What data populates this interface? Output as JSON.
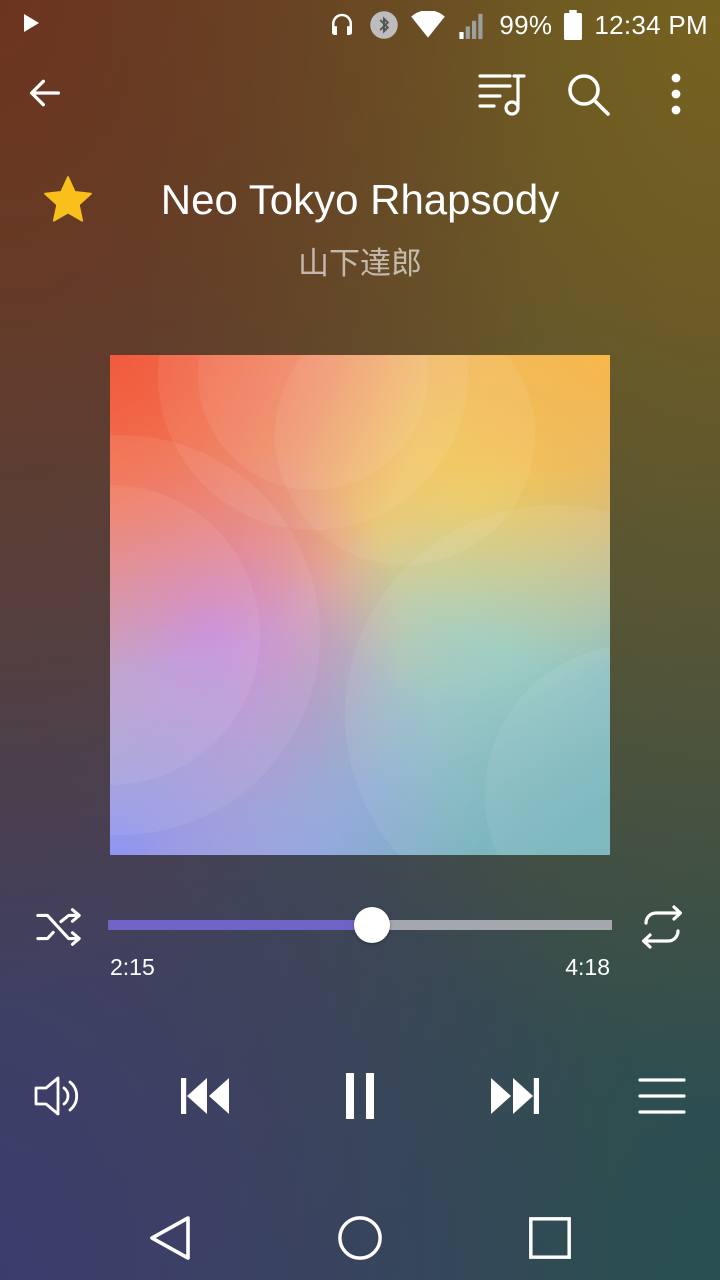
{
  "status_bar": {
    "battery_percent": "99%",
    "time": "12:34 PM",
    "icons": [
      "play-indicator-icon",
      "headphones-icon",
      "bluetooth-icon",
      "wifi-icon",
      "cellular-signal-icon",
      "battery-icon"
    ]
  },
  "app_bar": {
    "icons": [
      "back-arrow-icon",
      "queue-music-icon",
      "search-icon",
      "more-vert-icon"
    ]
  },
  "track": {
    "title": "Neo Tokyo Rhapsody",
    "artist": "山下達郎",
    "favorited": true
  },
  "progress": {
    "elapsed": "2:15",
    "total": "4:18",
    "fraction": 0.523
  },
  "controls": {
    "icons": [
      "shuffle-icon",
      "repeat-icon",
      "volume-icon",
      "skip-previous-icon",
      "pause-icon",
      "skip-next-icon",
      "playlist-icon"
    ]
  },
  "navigation_bar": {
    "icons": [
      "nav-back-icon",
      "nav-home-icon",
      "nav-recents-icon"
    ]
  },
  "colors": {
    "accent": "#6f64c6",
    "track_remaining": "#a4a7ad",
    "favorite_star": "#f9c01b",
    "artist_text": "#b5b0a3"
  }
}
